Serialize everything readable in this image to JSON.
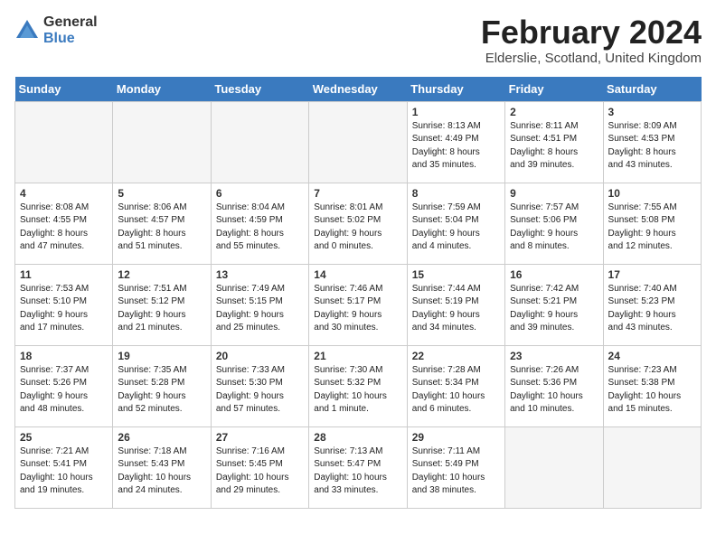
{
  "header": {
    "logo_general": "General",
    "logo_blue": "Blue",
    "month_title": "February 2024",
    "location": "Elderslie, Scotland, United Kingdom"
  },
  "days_of_week": [
    "Sunday",
    "Monday",
    "Tuesday",
    "Wednesday",
    "Thursday",
    "Friday",
    "Saturday"
  ],
  "weeks": [
    [
      {
        "day": "",
        "info": ""
      },
      {
        "day": "",
        "info": ""
      },
      {
        "day": "",
        "info": ""
      },
      {
        "day": "",
        "info": ""
      },
      {
        "day": "1",
        "info": "Sunrise: 8:13 AM\nSunset: 4:49 PM\nDaylight: 8 hours\nand 35 minutes."
      },
      {
        "day": "2",
        "info": "Sunrise: 8:11 AM\nSunset: 4:51 PM\nDaylight: 8 hours\nand 39 minutes."
      },
      {
        "day": "3",
        "info": "Sunrise: 8:09 AM\nSunset: 4:53 PM\nDaylight: 8 hours\nand 43 minutes."
      }
    ],
    [
      {
        "day": "4",
        "info": "Sunrise: 8:08 AM\nSunset: 4:55 PM\nDaylight: 8 hours\nand 47 minutes."
      },
      {
        "day": "5",
        "info": "Sunrise: 8:06 AM\nSunset: 4:57 PM\nDaylight: 8 hours\nand 51 minutes."
      },
      {
        "day": "6",
        "info": "Sunrise: 8:04 AM\nSunset: 4:59 PM\nDaylight: 8 hours\nand 55 minutes."
      },
      {
        "day": "7",
        "info": "Sunrise: 8:01 AM\nSunset: 5:02 PM\nDaylight: 9 hours\nand 0 minutes."
      },
      {
        "day": "8",
        "info": "Sunrise: 7:59 AM\nSunset: 5:04 PM\nDaylight: 9 hours\nand 4 minutes."
      },
      {
        "day": "9",
        "info": "Sunrise: 7:57 AM\nSunset: 5:06 PM\nDaylight: 9 hours\nand 8 minutes."
      },
      {
        "day": "10",
        "info": "Sunrise: 7:55 AM\nSunset: 5:08 PM\nDaylight: 9 hours\nand 12 minutes."
      }
    ],
    [
      {
        "day": "11",
        "info": "Sunrise: 7:53 AM\nSunset: 5:10 PM\nDaylight: 9 hours\nand 17 minutes."
      },
      {
        "day": "12",
        "info": "Sunrise: 7:51 AM\nSunset: 5:12 PM\nDaylight: 9 hours\nand 21 minutes."
      },
      {
        "day": "13",
        "info": "Sunrise: 7:49 AM\nSunset: 5:15 PM\nDaylight: 9 hours\nand 25 minutes."
      },
      {
        "day": "14",
        "info": "Sunrise: 7:46 AM\nSunset: 5:17 PM\nDaylight: 9 hours\nand 30 minutes."
      },
      {
        "day": "15",
        "info": "Sunrise: 7:44 AM\nSunset: 5:19 PM\nDaylight: 9 hours\nand 34 minutes."
      },
      {
        "day": "16",
        "info": "Sunrise: 7:42 AM\nSunset: 5:21 PM\nDaylight: 9 hours\nand 39 minutes."
      },
      {
        "day": "17",
        "info": "Sunrise: 7:40 AM\nSunset: 5:23 PM\nDaylight: 9 hours\nand 43 minutes."
      }
    ],
    [
      {
        "day": "18",
        "info": "Sunrise: 7:37 AM\nSunset: 5:26 PM\nDaylight: 9 hours\nand 48 minutes."
      },
      {
        "day": "19",
        "info": "Sunrise: 7:35 AM\nSunset: 5:28 PM\nDaylight: 9 hours\nand 52 minutes."
      },
      {
        "day": "20",
        "info": "Sunrise: 7:33 AM\nSunset: 5:30 PM\nDaylight: 9 hours\nand 57 minutes."
      },
      {
        "day": "21",
        "info": "Sunrise: 7:30 AM\nSunset: 5:32 PM\nDaylight: 10 hours\nand 1 minute."
      },
      {
        "day": "22",
        "info": "Sunrise: 7:28 AM\nSunset: 5:34 PM\nDaylight: 10 hours\nand 6 minutes."
      },
      {
        "day": "23",
        "info": "Sunrise: 7:26 AM\nSunset: 5:36 PM\nDaylight: 10 hours\nand 10 minutes."
      },
      {
        "day": "24",
        "info": "Sunrise: 7:23 AM\nSunset: 5:38 PM\nDaylight: 10 hours\nand 15 minutes."
      }
    ],
    [
      {
        "day": "25",
        "info": "Sunrise: 7:21 AM\nSunset: 5:41 PM\nDaylight: 10 hours\nand 19 minutes."
      },
      {
        "day": "26",
        "info": "Sunrise: 7:18 AM\nSunset: 5:43 PM\nDaylight: 10 hours\nand 24 minutes."
      },
      {
        "day": "27",
        "info": "Sunrise: 7:16 AM\nSunset: 5:45 PM\nDaylight: 10 hours\nand 29 minutes."
      },
      {
        "day": "28",
        "info": "Sunrise: 7:13 AM\nSunset: 5:47 PM\nDaylight: 10 hours\nand 33 minutes."
      },
      {
        "day": "29",
        "info": "Sunrise: 7:11 AM\nSunset: 5:49 PM\nDaylight: 10 hours\nand 38 minutes."
      },
      {
        "day": "",
        "info": ""
      },
      {
        "day": "",
        "info": ""
      }
    ]
  ]
}
